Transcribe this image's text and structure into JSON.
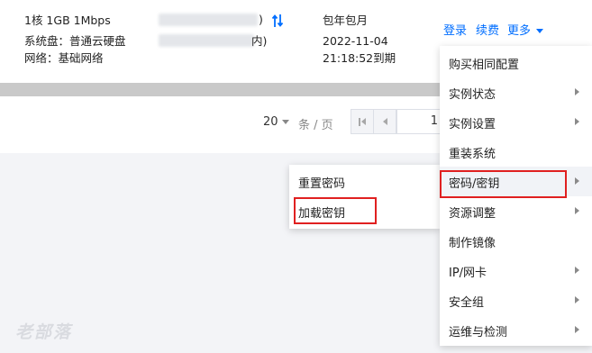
{
  "instance": {
    "spec_line1": "1核 1GB 1Mbps",
    "spec_line2": "系统盘：普通云硬盘",
    "spec_line3": "网络：基础网络",
    "ip_suffix1": ")",
    "ip_suffix2": "内)",
    "billing_type": "包年包月",
    "expire_date": "2022-11-04",
    "expire_time": "21:18:52到期"
  },
  "actions": {
    "login": "登录",
    "renew": "续费",
    "more": "更多"
  },
  "pager": {
    "page_size": "20",
    "per_page_label": "条 / 页",
    "current_page": "1"
  },
  "more_menu": {
    "items": [
      {
        "label": "购买相同配置",
        "has_submenu": false
      },
      {
        "label": "实例状态",
        "has_submenu": true
      },
      {
        "label": "实例设置",
        "has_submenu": true
      },
      {
        "label": "重装系统",
        "has_submenu": false
      },
      {
        "label": "密码/密钥",
        "has_submenu": true,
        "highlighted": true
      },
      {
        "label": "资源调整",
        "has_submenu": true
      },
      {
        "label": "制作镜像",
        "has_submenu": false
      },
      {
        "label": "IP/网卡",
        "has_submenu": true
      },
      {
        "label": "安全组",
        "has_submenu": true
      },
      {
        "label": "运维与检测",
        "has_submenu": true
      }
    ]
  },
  "submenu": {
    "items": [
      {
        "label": "重置密码"
      },
      {
        "label": "加载密钥"
      }
    ]
  },
  "watermark": "老部落",
  "colors": {
    "link": "#006eff",
    "highlight_border": "#e02020",
    "hover_bg": "#f1f3f7"
  }
}
